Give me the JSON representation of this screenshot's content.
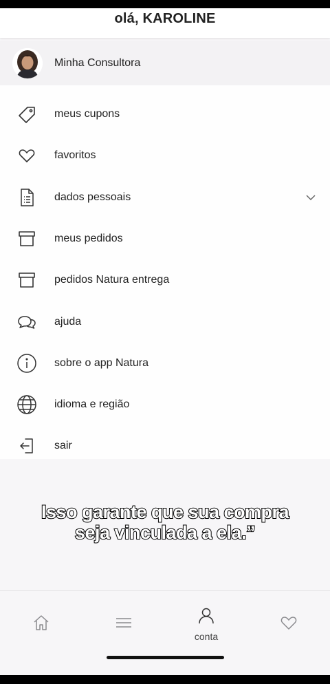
{
  "header": {
    "title": "olá, KAROLINE"
  },
  "consultant": {
    "label": "Minha Consultora"
  },
  "menu": {
    "items": [
      {
        "label": "meus cupons",
        "icon": "tag-icon"
      },
      {
        "label": "favoritos",
        "icon": "heart-icon"
      },
      {
        "label": "dados pessoais",
        "icon": "document-list-icon",
        "expandable": true
      },
      {
        "label": "meus pedidos",
        "icon": "box-icon"
      },
      {
        "label": "pedidos Natura entrega",
        "icon": "box-icon"
      },
      {
        "label": "ajuda",
        "icon": "chat-bubbles-icon"
      },
      {
        "label": "sobre o app Natura",
        "icon": "info-icon"
      },
      {
        "label": "idioma e região",
        "icon": "globe-icon"
      },
      {
        "label": "sair",
        "icon": "logout-icon"
      }
    ]
  },
  "caption": {
    "text": "Isso garante que sua compra seja vinculada a ela.”"
  },
  "tabbar": {
    "tabs": [
      {
        "icon": "home-icon",
        "label": ""
      },
      {
        "icon": "menu-icon",
        "label": ""
      },
      {
        "icon": "user-icon",
        "label": "conta",
        "active": true
      },
      {
        "icon": "heart-icon",
        "label": ""
      }
    ]
  }
}
